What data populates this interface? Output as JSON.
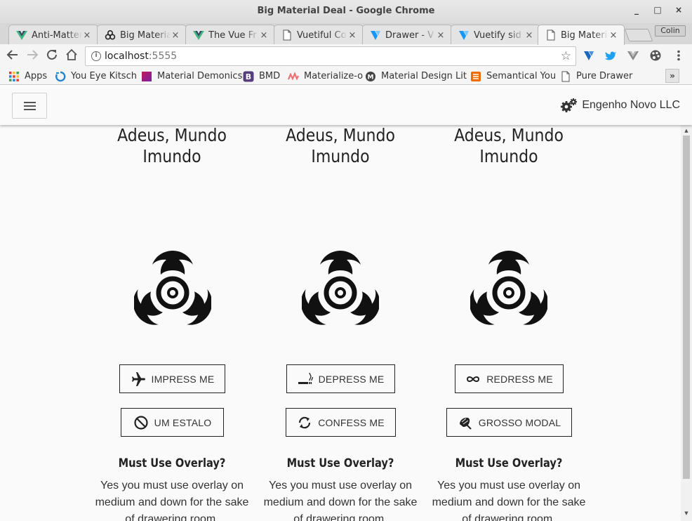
{
  "window": {
    "title": "Big Material Deal - Google Chrome",
    "controls": [
      "_",
      "□",
      "×"
    ]
  },
  "tabs": [
    {
      "title": "Anti-Matter",
      "icon": "vue-logo-icon",
      "active": false
    },
    {
      "title": "Big Material",
      "icon": "biohazard-icon",
      "active": false
    },
    {
      "title": "The Vue Fr",
      "icon": "vue-logo-icon",
      "active": false
    },
    {
      "title": "Vuetiful Co",
      "icon": "page-icon",
      "active": false
    },
    {
      "title": "Drawer - V",
      "icon": "vuetify-logo-icon",
      "active": false
    },
    {
      "title": "Vuetify sid",
      "icon": "vuetify-logo-icon",
      "active": false
    },
    {
      "title": "Big Materia",
      "icon": "page-icon",
      "active": true
    }
  ],
  "profile_name": "Colin",
  "address": {
    "host": "localhost",
    "port": ":5555"
  },
  "bookmarks": [
    {
      "label": "Apps",
      "icon": "apps-grid-icon"
    },
    {
      "label": "You Eye Kitsch",
      "icon": "ring-logo-icon"
    },
    {
      "label": "Material Demonics",
      "icon": "square-logo-icon"
    },
    {
      "label": "BMD",
      "icon": "bootstrap-b-icon"
    },
    {
      "label": "Materialize-o",
      "icon": "materialize-m-icon"
    },
    {
      "label": "Material Design Lit",
      "icon": "circle-m-icon"
    },
    {
      "label": "Semantical You",
      "icon": "orange-square-icon"
    },
    {
      "label": "Pure Drawer",
      "icon": "page-icon"
    }
  ],
  "app": {
    "brand": "Engenho Novo LLC",
    "columns": [
      {
        "title_line1": "Adeus, Mundo",
        "title_line2": "Imundo",
        "buttons": [
          {
            "label": "IMPRESS ME",
            "icon": "airplane-icon"
          },
          {
            "label": "UM ESTALO",
            "icon": "block-icon"
          }
        ],
        "subtitle": "Must Use Overlay?",
        "body": "Yes you must use overlay on medium and down for the sake of drawering room."
      },
      {
        "title_line1": "Adeus, Mundo",
        "title_line2": "Imundo",
        "buttons": [
          {
            "label": "DEPRESS ME",
            "icon": "smoking-icon"
          },
          {
            "label": "CONFESS ME",
            "icon": "sync-icon"
          }
        ],
        "subtitle": "Must Use Overlay?",
        "body": "Yes you must use overlay on medium and down for the sake of drawering room."
      },
      {
        "title_line1": "Adeus, Mundo",
        "title_line2": "Imundo",
        "buttons": [
          {
            "label": "REDRESS ME",
            "icon": "infinity-icon"
          },
          {
            "label": "GROSSO MODAL",
            "icon": "beach-umbrella-icon"
          }
        ],
        "subtitle": "Must Use Overlay?",
        "body": "Yes you must use overlay on medium and down for the sake of drawering room."
      }
    ]
  }
}
